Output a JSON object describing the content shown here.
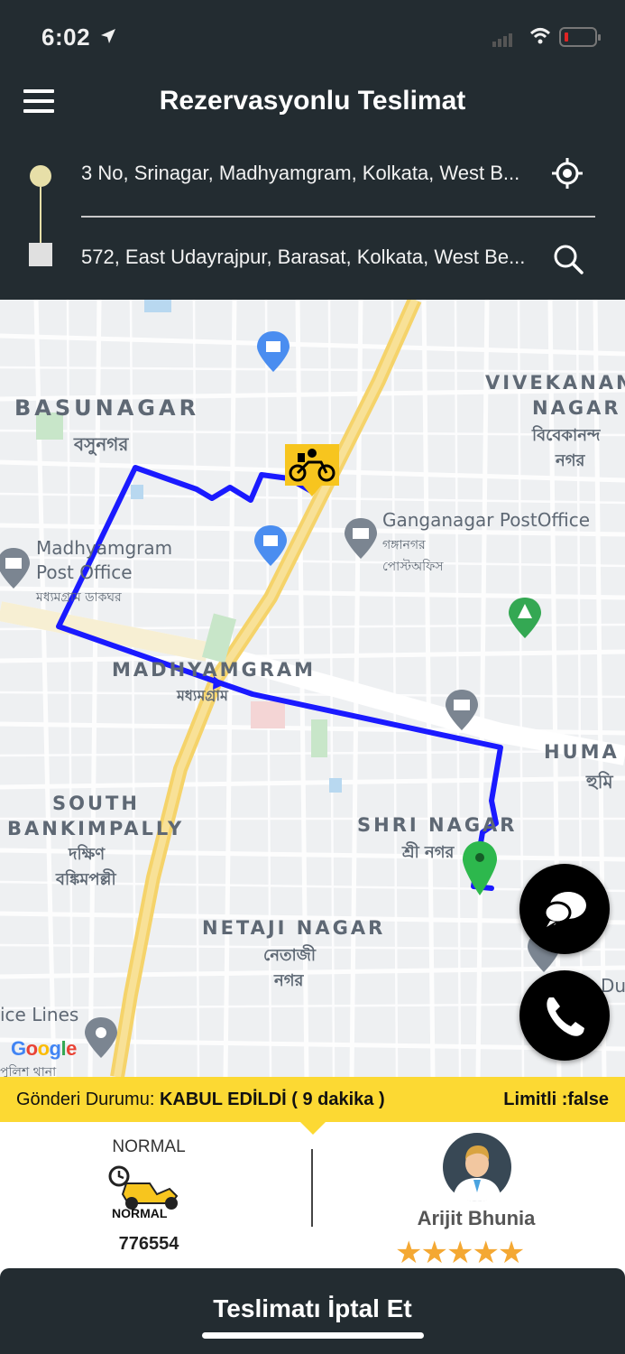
{
  "status_bar": {
    "time": "6:02"
  },
  "header": {
    "title": "Rezervasyonlu Teslimat"
  },
  "addresses": {
    "from": "3 No, Srinagar, Madhyamgram, Kolkata, West B...",
    "to": "572, East Udayrajpur, Barasat, Kolkata, West Be..."
  },
  "map": {
    "labels": {
      "basunagar": "BASUNAGAR",
      "basunagar_bn": "বসুনগর",
      "vivekananda_1": "VIVEKANAN",
      "vivekananda_2": "NAGAR",
      "vivekananda_bn_1": "বিবেকানন্দ",
      "vivekananda_bn_2": "নগর",
      "ganganagar_po": "Ganganagar PostOffice",
      "ganganagar_po_bn_1": "গঙ্গানগর",
      "ganganagar_po_bn_2": "পোস্টঅফিস",
      "madhyamgram_po_1": "Madhyamgram",
      "madhyamgram_po_2": "Post Office",
      "madhyamgram_po_bn": "মধ্যমগ্রাম ডাকঘর",
      "madhyamgram": "MADHYAMGRAM",
      "madhyamgram_bn": "মধ্যমগ্রাম",
      "huma": "HUMA",
      "huma_bn": "হুমি",
      "south_bankimpally_1": "SOUTH",
      "south_bankimpally_2": "BANKIMPALLY",
      "south_bankimpally_bn_1": "দক্ষিণ",
      "south_bankimpally_bn_2": "বঙ্কিমপল্লী",
      "shri_nagar": "SHRI NAGAR",
      "shri_nagar_bn": "শ্রী নগর",
      "netaji_nagar": "NETAJI NAGAR",
      "netaji_nagar_bn_1": "নেতাজী",
      "netaji_nagar_bn_2": "নগর",
      "ice_lines": "ice Lines",
      "du": "Du",
      "footer_bn": "পুলিশ থানা"
    },
    "google_logo": [
      "G",
      "o",
      "o",
      "g",
      "l",
      "e"
    ],
    "route_color": "#1a1aff",
    "destination_pin_color": "#2db84d",
    "courier_marker_color": "#f7c51e"
  },
  "shipment": {
    "status_label": "Gönderi Durumu:",
    "status_value": "KABUL EDİLDİ ( 9 dakika )",
    "limit": "Limitli :false"
  },
  "service": {
    "type": "NORMAL",
    "icon_label": "NORMAL",
    "code": "776554"
  },
  "driver": {
    "name": "Arijit Bhunia",
    "rating": 5,
    "rating_display": "★★★★★"
  },
  "actions": {
    "cancel": "Teslimatı İptal Et"
  },
  "colors": {
    "dark_bg": "#232c31",
    "accent_yellow": "#fcd933",
    "star": "#f4a833"
  }
}
